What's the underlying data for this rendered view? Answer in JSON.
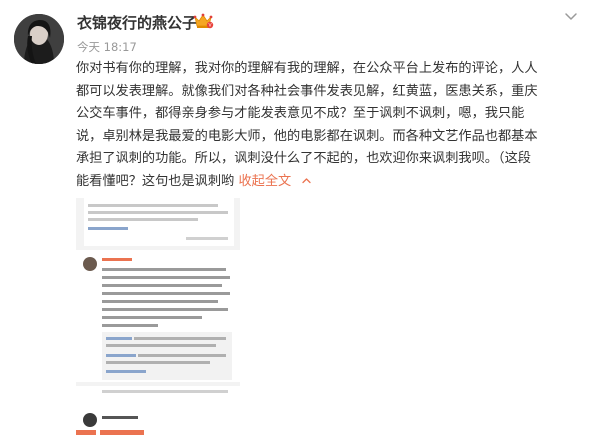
{
  "post": {
    "username": "衣锦夜行的燕公子",
    "timestamp": "今天 18:17",
    "badge_icon": "vip-fan-badge-icon",
    "text_lines": [
      "你对书有你的理解，我对你的理解有我的理解，在公众平台上发布的评论，人人",
      "都可以发表理解。就像我们对各种社会事件发表见解，红黄蓝，医患关系，重庆",
      "公交车事件，都得亲身参与才能发表意见不成？至于讽刺不讽刺，嗯，我只能",
      "说，卓别林是我最爱的电影大师，他的电影都在讽刺。而各种文艺作品也都基本",
      "承担了讽刺的功能。所以，讽刺没什么了不起的，也欢迎你来讽刺我呗。（这段"
    ],
    "last_line_text": "能看懂吧？这句也是讽刺哟",
    "collapse_label": "收起全文",
    "accent_color": "#eb7350"
  },
  "screenshot_thumb": {
    "commenter_name": "马筱羽",
    "reply_names": [
      "路情源：",
      "twik1020："
    ],
    "link_text": "共16条回复",
    "link_text_2": "共45条回复",
    "replier_name": "所有被讽刺..."
  }
}
